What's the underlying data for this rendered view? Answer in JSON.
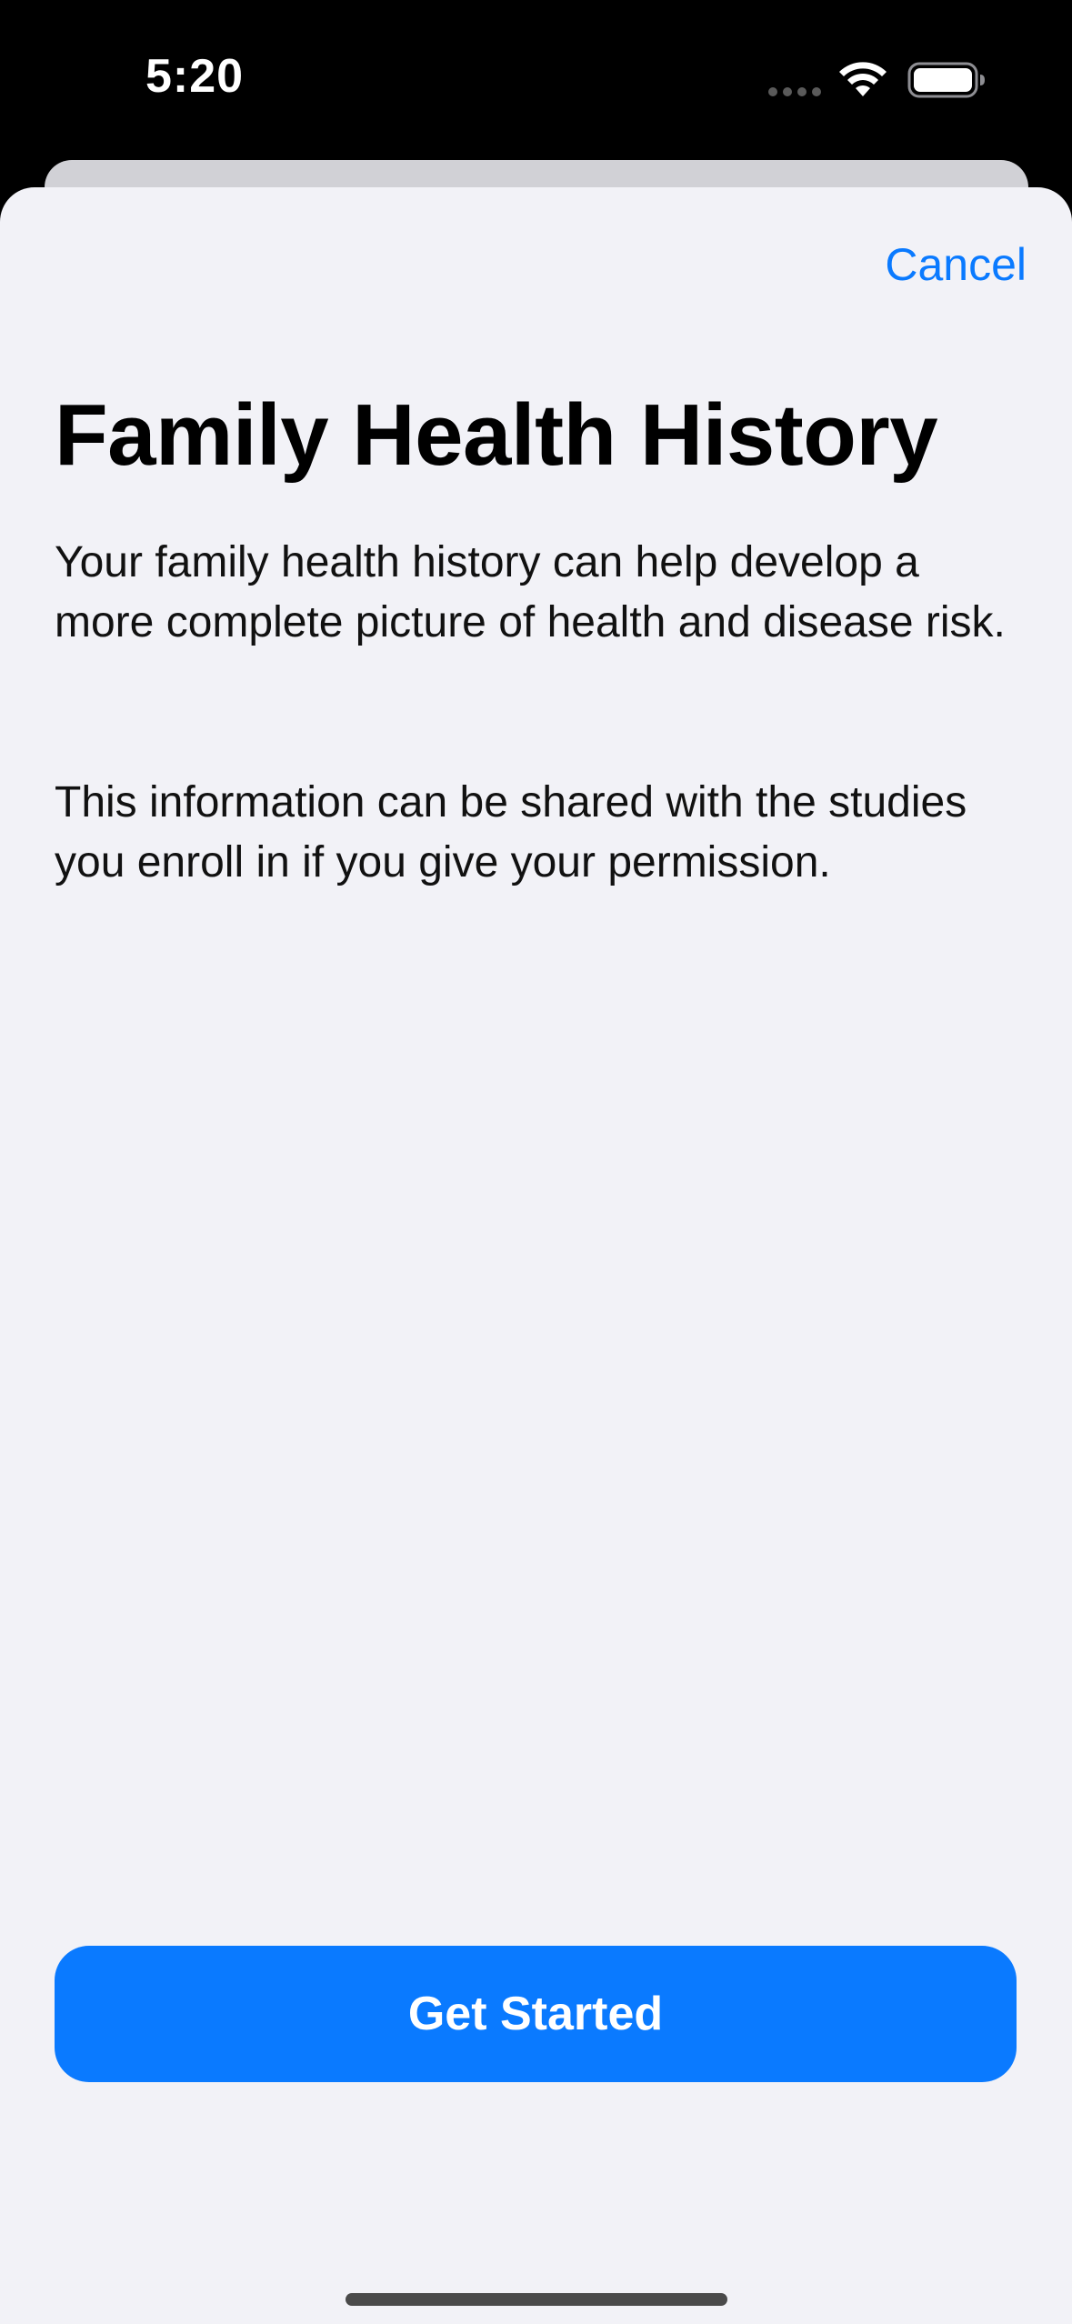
{
  "status_bar": {
    "time": "5:20",
    "icons": [
      "signal-dots-icon",
      "wifi-icon",
      "battery-icon"
    ]
  },
  "sheet": {
    "cancel_label": "Cancel",
    "title": "Family Health History",
    "paragraphs": [
      "Your family health history can help develop a more complete picture of health and disease risk.",
      "This information can be shared with the studies you enroll in if you give your permission."
    ],
    "primary_button_label": "Get Started"
  },
  "colors": {
    "accent": "#0a7aff",
    "sheet_background": "#f2f2f7",
    "status_bar_background": "#000000"
  }
}
